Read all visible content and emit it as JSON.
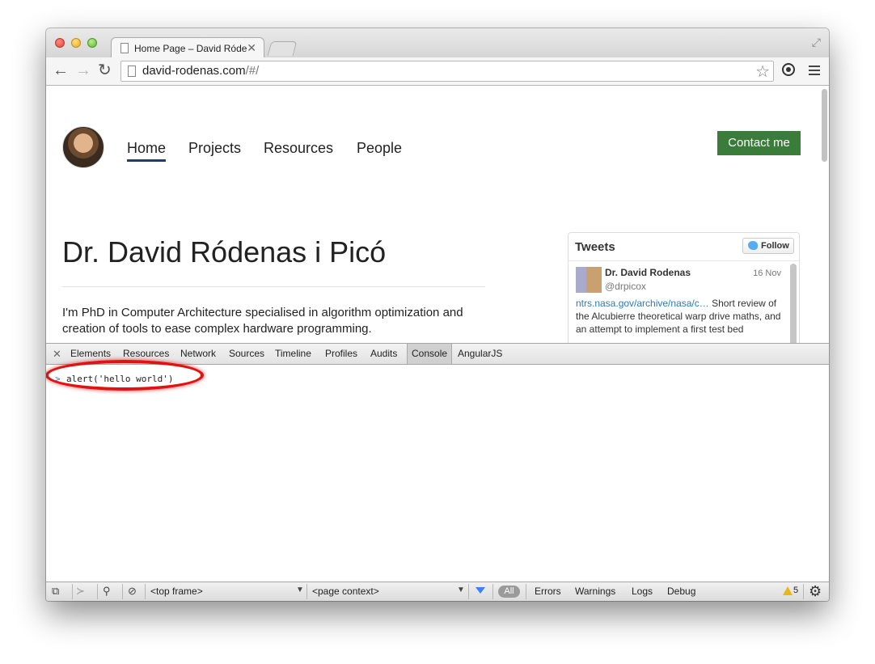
{
  "browser": {
    "tab_title": "Home Page – David Ródenas i Picó",
    "url_domain": "david-rodenas.com",
    "url_path": "/#/"
  },
  "site": {
    "nav": [
      "Home",
      "Projects",
      "Resources",
      "People"
    ],
    "contact_label": "Contact me",
    "title": "Dr. David Ródenas i Picó",
    "intro": "I'm PhD in Computer Architecture specialised in algorithm optimization and creation of tools to ease complex hardware programming."
  },
  "tweets": {
    "title": "Tweets",
    "follow_label": "Follow",
    "author": "Dr. David Rodenas",
    "handle": "@drpicox",
    "date": "16 Nov",
    "link": "ntrs.nasa.gov/archive/nasa/c…",
    "text": "Short review of the Alcubierre theoretical warp drive maths, and an attempt to implement a first test bed"
  },
  "devtools": {
    "tabs": [
      "Elements",
      "Resources",
      "Network",
      "Sources",
      "Timeline",
      "Profiles",
      "Audits",
      "Console",
      "AngularJS"
    ],
    "active_tab": "Console",
    "prompt": ">",
    "command": "alert('hello world')",
    "frame_select": "<top frame>",
    "context_select": "<page context>",
    "filter_all": "All",
    "filters": [
      "Errors",
      "Warnings",
      "Logs",
      "Debug"
    ],
    "warning_count": "5"
  },
  "colors": {
    "contact_button": "#3a7d3a",
    "nav_active_underline": "#1e3c72",
    "highlight_ellipse": "#e21212",
    "tweet_link": "#2b7bb9"
  }
}
